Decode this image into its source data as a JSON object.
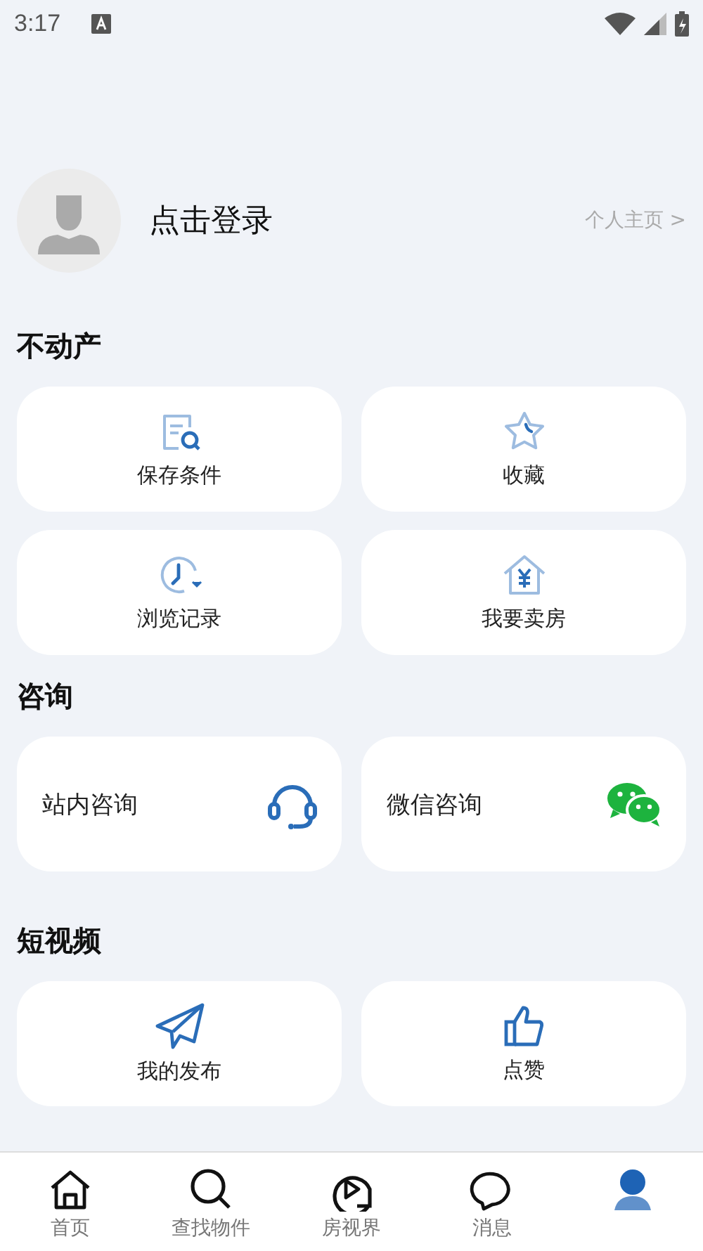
{
  "status_bar": {
    "time": "3:17"
  },
  "profile": {
    "login": "点击登录",
    "homepage_link": "个人主页 >"
  },
  "sections": [
    {
      "title": "不动产",
      "kind": "grid",
      "items": [
        {
          "label": "保存条件",
          "kind": "criteria"
        },
        {
          "label": "收藏",
          "kind": "favorite"
        },
        {
          "label": "浏览记录",
          "kind": "history"
        },
        {
          "label": "我要卖房",
          "kind": "sell"
        }
      ]
    },
    {
      "title": "咨询",
      "kind": "row",
      "items": [
        {
          "label": "站内咨询",
          "kind": "support"
        },
        {
          "label": "微信咨询",
          "kind": "wechat"
        }
      ]
    },
    {
      "title": "短视频",
      "kind": "grid",
      "items": [
        {
          "label": "我的发布",
          "kind": "publish"
        },
        {
          "label": "点赞",
          "kind": "like"
        }
      ]
    }
  ],
  "tab_bar": [
    {
      "label": "首页",
      "kind": "home",
      "selected": false
    },
    {
      "label": "查找物件",
      "kind": "search",
      "selected": false
    },
    {
      "label": "房视界",
      "kind": "video",
      "selected": false
    },
    {
      "label": "消息",
      "kind": "message",
      "selected": false
    },
    {
      "kind": "profile",
      "selected": true
    }
  ]
}
